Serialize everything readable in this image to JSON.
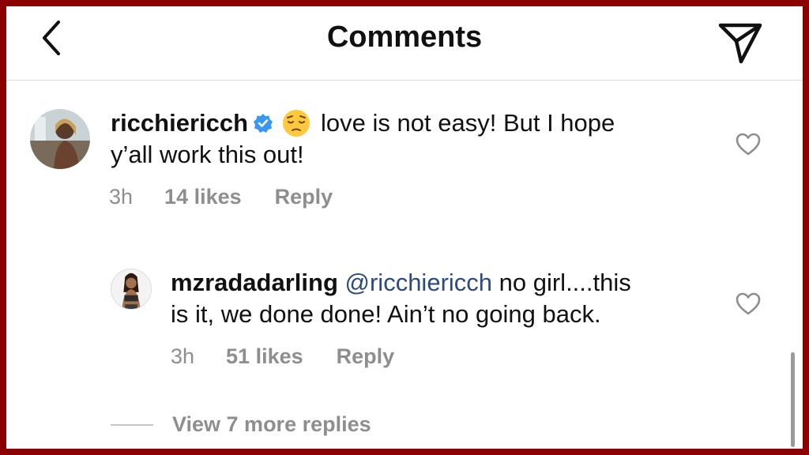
{
  "header": {
    "title": "Comments",
    "back_icon": "chevron-left-icon",
    "send_icon": "paper-plane-icon"
  },
  "comments": [
    {
      "username": "ricchiericch",
      "verified": true,
      "emoji": "pensive-face",
      "text_line1": "love is not easy! But I hope",
      "text_line2": "y’all work this out!",
      "time": "3h",
      "likes": "14 likes",
      "reply": "Reply"
    }
  ],
  "replies": [
    {
      "username": "mzradadarling",
      "mention": "@ricchiericch",
      "text_line1": "no girl....this",
      "text_line2": "is it, we done done! Ain’t no going back.",
      "time": "3h",
      "likes": "51 likes",
      "reply": "Reply"
    }
  ],
  "view_more": "View 7 more replies",
  "colors": {
    "frame": "#8b0000",
    "meta_text": "#8e8e8e",
    "verified_badge": "#3897f0",
    "mention": "#2d4a7a"
  }
}
